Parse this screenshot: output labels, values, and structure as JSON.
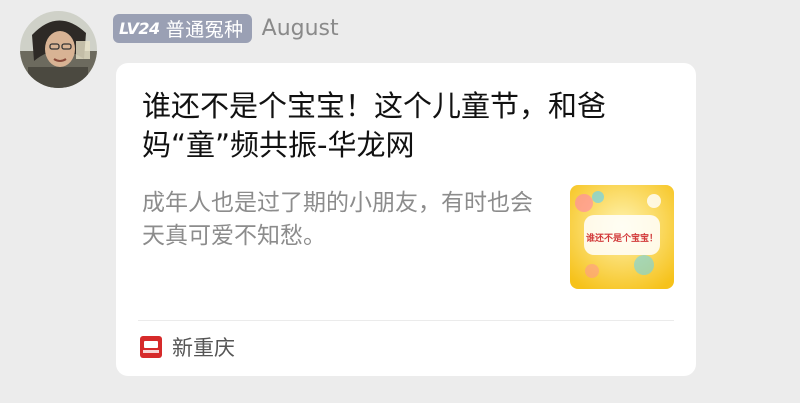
{
  "post": {
    "level_badge": "LV24",
    "user_title": "普通冤种",
    "author": "August"
  },
  "card": {
    "headline": "谁还不是个宝宝！这个儿童节，和爸妈“童”频共振-华龙网",
    "summary": "成年人也是过了期的小朋友，有时也会天真可爱不知愁。",
    "thumbnail_text": "谁还不是个宝宝！",
    "source": "新重庆"
  },
  "colors": {
    "badge_bg": "#9aa0b4",
    "card_bg": "#ffffff",
    "page_bg": "#ececec",
    "source_logo": "#d62a2a"
  }
}
